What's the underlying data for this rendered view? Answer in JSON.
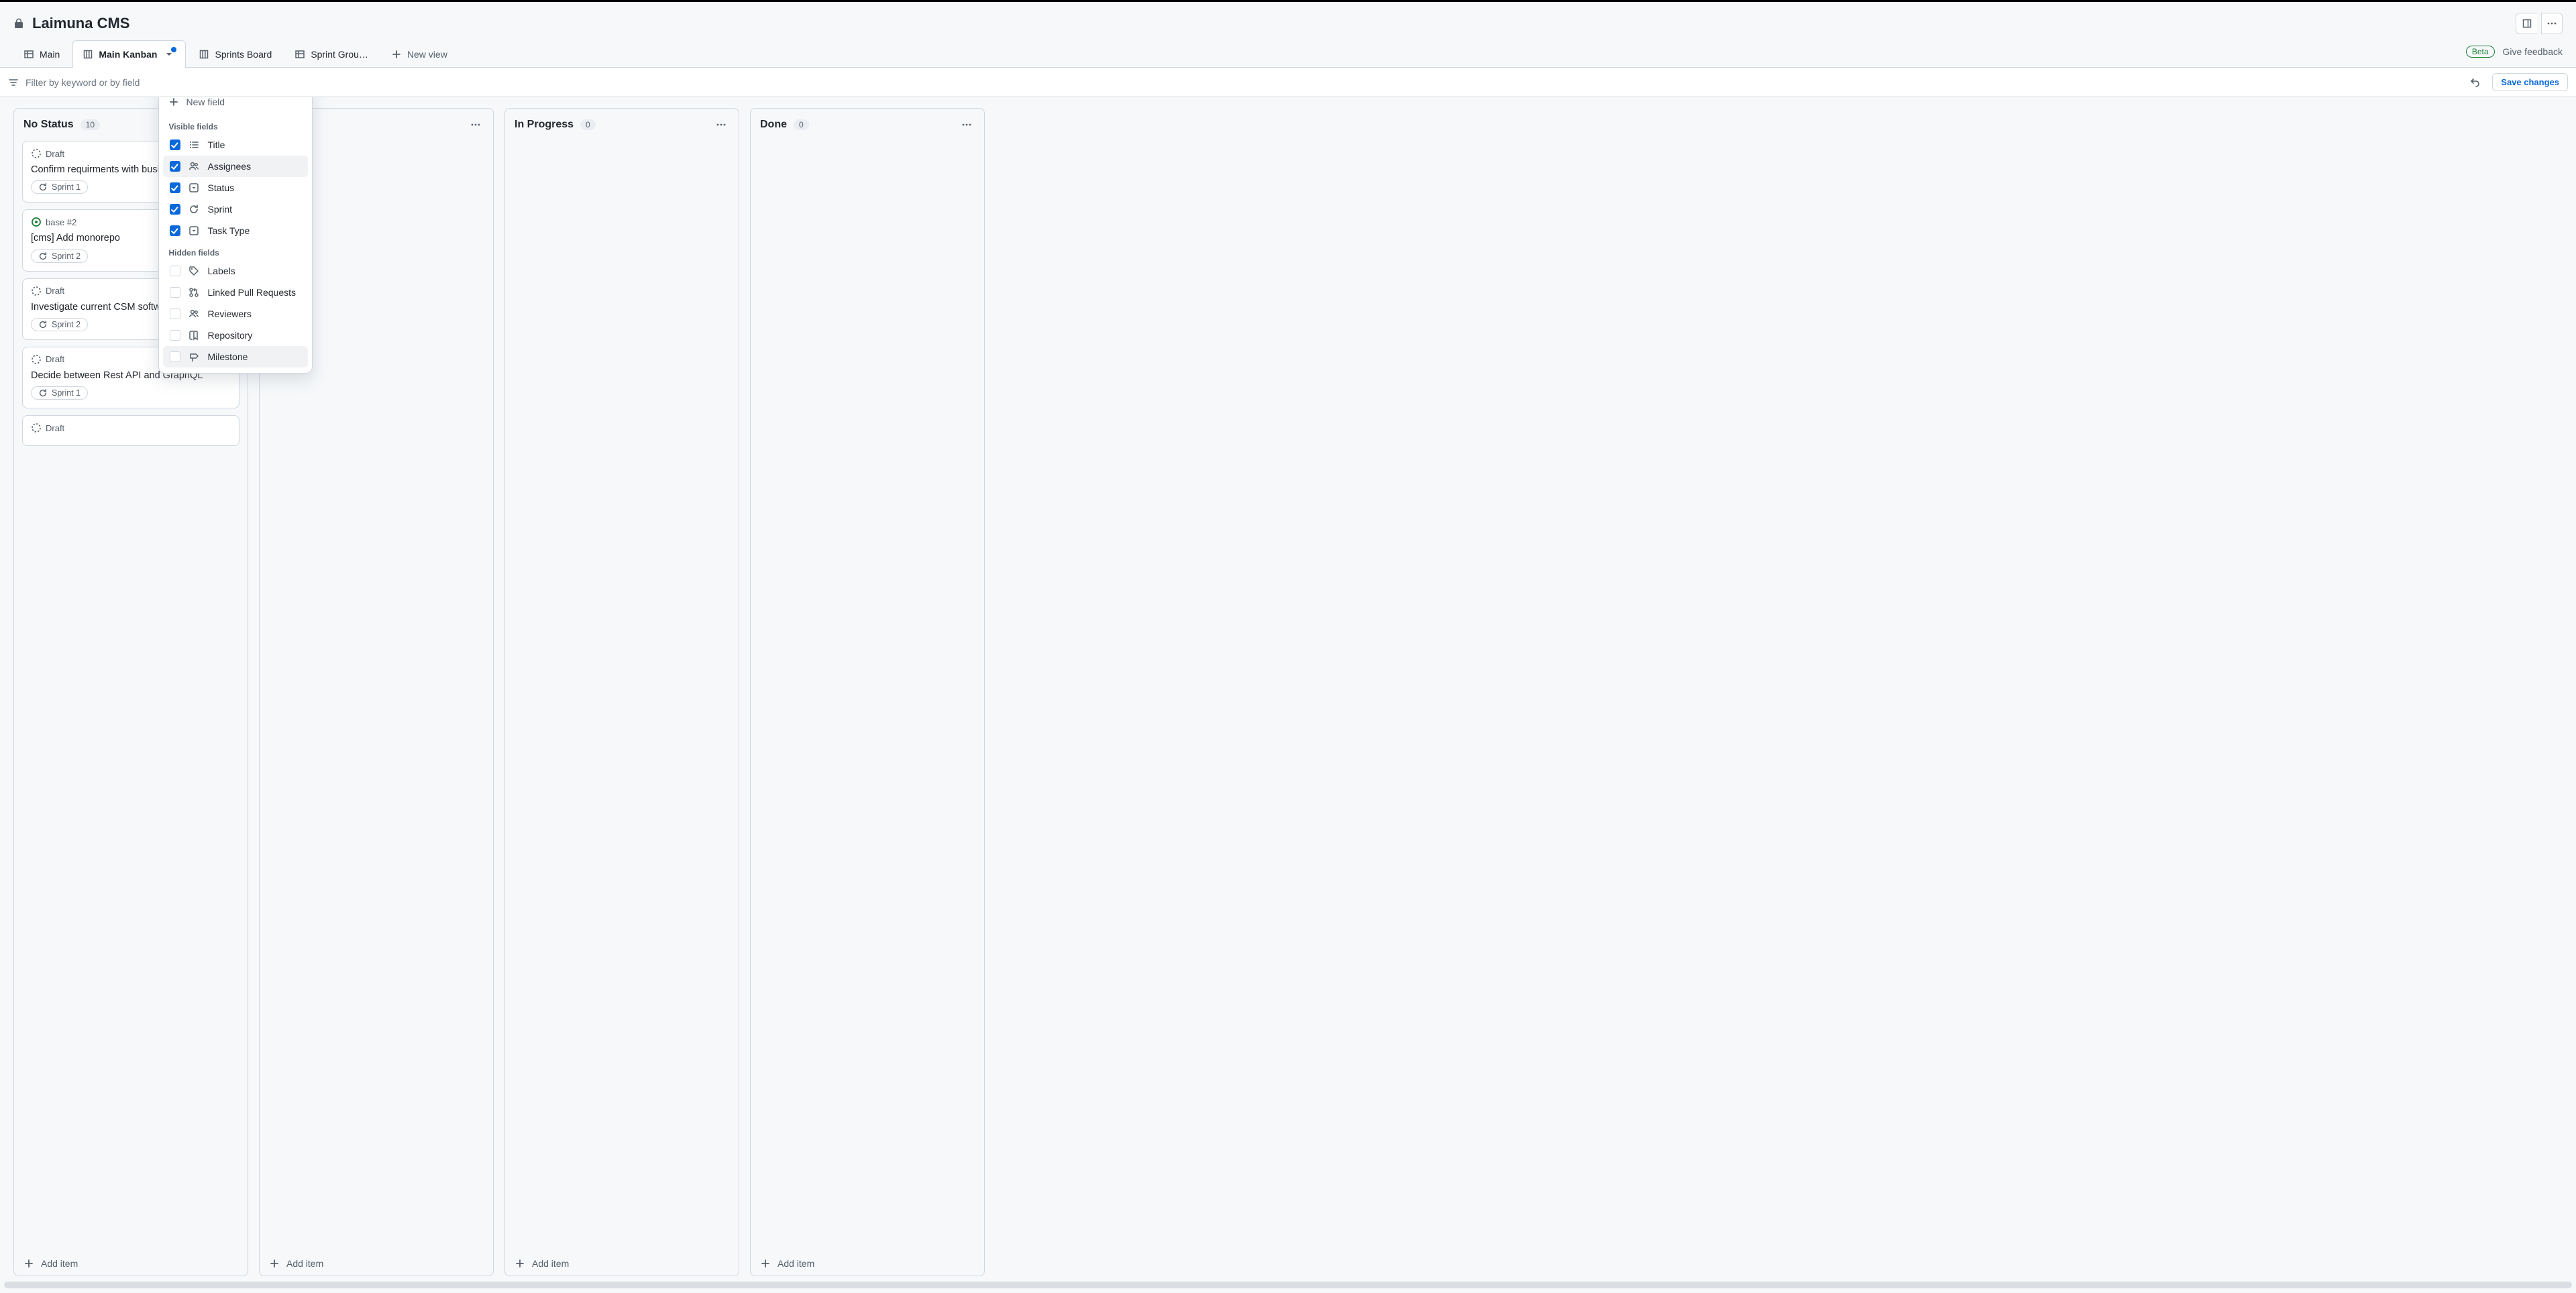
{
  "header": {
    "title": "Laimuna CMS"
  },
  "tabs": [
    {
      "id": "main",
      "label": "Main",
      "icon": "table",
      "active": false,
      "truncated": false
    },
    {
      "id": "main-kanban",
      "label": "Main Kanban",
      "icon": "board",
      "active": true,
      "truncated": false,
      "has_indicator": true
    },
    {
      "id": "sprints-board",
      "label": "Sprints Board",
      "icon": "board",
      "active": false,
      "truncated": false
    },
    {
      "id": "sprint-group",
      "label": "Sprint Grou…",
      "icon": "table",
      "active": false,
      "truncated": true
    }
  ],
  "new_view_label": "New view",
  "beta_label": "Beta",
  "feedback_label": "Give feedback",
  "filter": {
    "placeholder": "Filter by keyword or by field",
    "save_label": "Save changes"
  },
  "columns": [
    {
      "id": "no-status",
      "title": "No Status",
      "count": 10,
      "add_item_label": "Add item",
      "cards": [
        {
          "status_icon": "draft",
          "status_label": "Draft",
          "title": "Confirm requirments with business",
          "sprint": "Sprint 1"
        },
        {
          "status_icon": "issue",
          "status_label": "base #2",
          "title": "[cms] Add monorepo",
          "sprint": "Sprint 2"
        },
        {
          "status_icon": "draft",
          "status_label": "Draft",
          "title": "Investigate current CSM software",
          "sprint": "Sprint 2"
        },
        {
          "status_icon": "draft",
          "status_label": "Draft",
          "title": "Decide between Rest API and GraphQL",
          "sprint": "Sprint 1"
        },
        {
          "status_icon": "draft",
          "status_label": "Draft",
          "title": "",
          "sprint": null
        }
      ]
    },
    {
      "id": "todo",
      "title": "",
      "count": null,
      "add_item_label": "Add item",
      "cards": []
    },
    {
      "id": "in-progress",
      "title": "In Progress",
      "count": 0,
      "add_item_label": "Add item",
      "cards": []
    },
    {
      "id": "done",
      "title": "Done",
      "count": 0,
      "add_item_label": "Add item",
      "cards": []
    }
  ],
  "field_menu": {
    "new_field_label": "New field",
    "visible_label": "Visible fields",
    "hidden_label": "Hidden fields",
    "visible": [
      {
        "id": "title",
        "label": "Title",
        "icon": "list",
        "checked": true,
        "hover": false
      },
      {
        "id": "assignees",
        "label": "Assignees",
        "icon": "people",
        "checked": true,
        "hover": true
      },
      {
        "id": "status",
        "label": "Status",
        "icon": "select",
        "checked": true,
        "hover": false
      },
      {
        "id": "sprint",
        "label": "Sprint",
        "icon": "iteration",
        "checked": true,
        "hover": false
      },
      {
        "id": "task-type",
        "label": "Task Type",
        "icon": "select",
        "checked": true,
        "hover": false
      }
    ],
    "hidden": [
      {
        "id": "labels",
        "label": "Labels",
        "icon": "tag",
        "checked": false,
        "hover": false
      },
      {
        "id": "linked-pr",
        "label": "Linked Pull Requests",
        "icon": "pr",
        "checked": false,
        "hover": false
      },
      {
        "id": "reviewers",
        "label": "Reviewers",
        "icon": "people",
        "checked": false,
        "hover": false
      },
      {
        "id": "repository",
        "label": "Repository",
        "icon": "repo",
        "checked": false,
        "hover": false
      },
      {
        "id": "milestone",
        "label": "Milestone",
        "icon": "milestone",
        "checked": false,
        "hover": true
      }
    ]
  }
}
